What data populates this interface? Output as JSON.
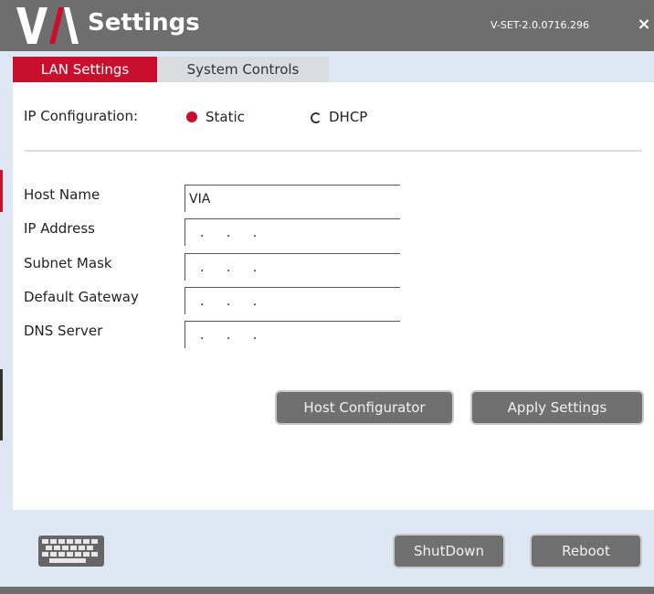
{
  "header": {
    "title": "Settings",
    "version": "V-SET-2.0.0716.296",
    "close_label": "×"
  },
  "tabs": [
    {
      "label": "LAN Settings",
      "active": true
    },
    {
      "label": "System Controls",
      "active": false
    }
  ],
  "ip_config": {
    "label": "IP Configuration:",
    "options": [
      {
        "label": "Static",
        "selected": true
      },
      {
        "label": "DHCP",
        "selected": false
      }
    ]
  },
  "fields": {
    "host_name": {
      "label": "Host Name",
      "value": "VIA"
    },
    "ip_address": {
      "label": "IP Address",
      "value": ". . ."
    },
    "subnet_mask": {
      "label": "Subnet Mask",
      "value": ". . ."
    },
    "default_gateway": {
      "label": "Default Gateway",
      "value": ". . ."
    },
    "dns_server": {
      "label": "DNS Server",
      "value": ". . ."
    }
  },
  "buttons": {
    "host_configurator": "Host Configurator",
    "apply_settings": "Apply Settings",
    "shutdown": "ShutDown",
    "reboot": "Reboot"
  },
  "colors": {
    "accent": "#c8102e",
    "titlebar": "#6e6e6e",
    "button": "#707070",
    "background": "#dde8f4"
  },
  "icons": {
    "logo": "via-logo",
    "close": "close-icon",
    "keyboard": "keyboard-icon"
  }
}
